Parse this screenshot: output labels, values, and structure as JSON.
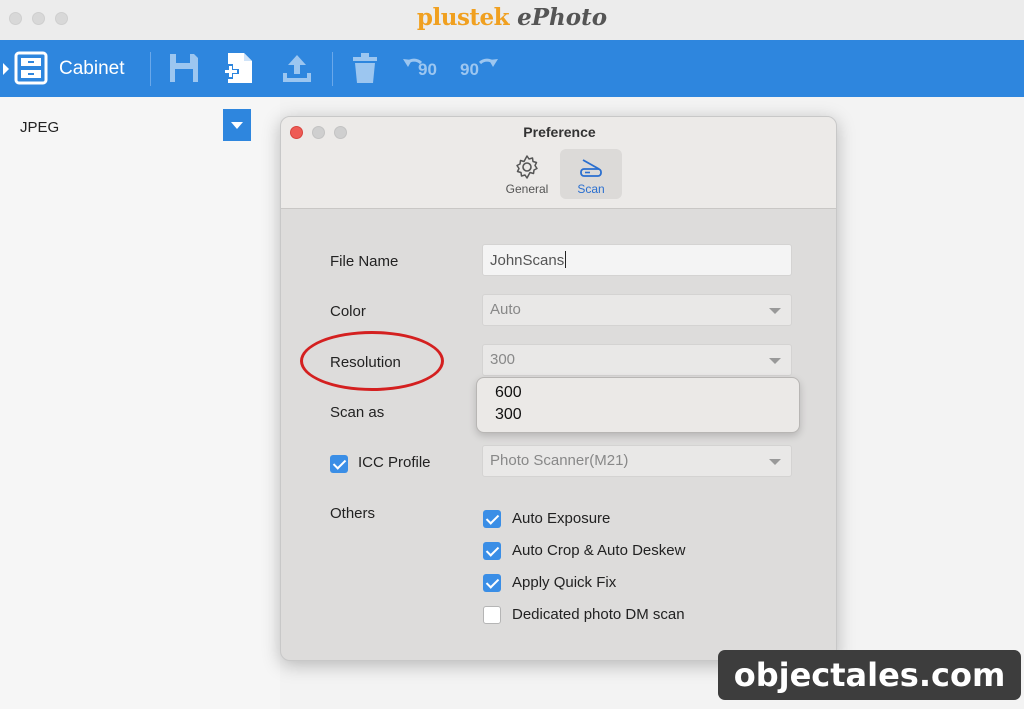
{
  "app": {
    "brand": "plustek",
    "name": "ePhoto"
  },
  "toolbar": {
    "cabinet_label": "Cabinet",
    "rotate_left_label": "90",
    "rotate_right_label": "90",
    "accent_color": "#2e86de"
  },
  "left_panel": {
    "format_value": "JPEG"
  },
  "preference": {
    "title": "Preference",
    "tabs": [
      {
        "label": "General",
        "icon": "gear-icon",
        "active": false
      },
      {
        "label": "Scan",
        "icon": "scanner-icon",
        "active": true
      }
    ],
    "file_name": {
      "label": "File Name",
      "value": "JohnScans"
    },
    "color": {
      "label": "Color",
      "value": "Auto"
    },
    "resolution": {
      "label": "Resolution",
      "value": "300",
      "options": [
        "600",
        "300"
      ]
    },
    "scan_as": {
      "label": "Scan as"
    },
    "icc_profile": {
      "label": "ICC Profile",
      "checked": true,
      "value": "Photo Scanner(M21)"
    },
    "others": {
      "label": "Others",
      "options": [
        {
          "label": "Auto Exposure",
          "checked": true
        },
        {
          "label": "Auto Crop & Auto Deskew",
          "checked": true
        },
        {
          "label": "Apply Quick Fix",
          "checked": true
        },
        {
          "label": "Dedicated photo DM scan",
          "checked": false
        }
      ]
    }
  },
  "watermark": "objectales.com"
}
